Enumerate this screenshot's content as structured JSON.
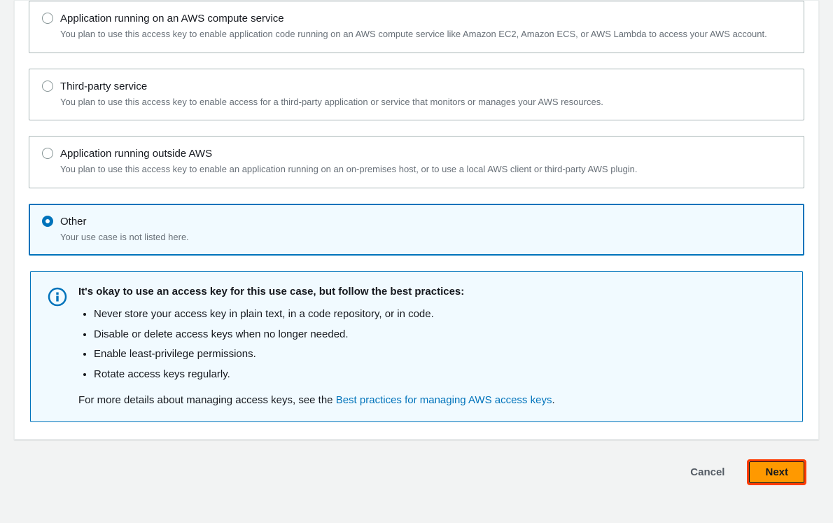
{
  "options": [
    {
      "title": "Application running on an AWS compute service",
      "desc": "You plan to use this access key to enable application code running on an AWS compute service like Amazon EC2, Amazon ECS, or AWS Lambda to access your AWS account.",
      "selected": false
    },
    {
      "title": "Third-party service",
      "desc": "You plan to use this access key to enable access for a third-party application or service that monitors or manages your AWS resources.",
      "selected": false
    },
    {
      "title": "Application running outside AWS",
      "desc": "You plan to use this access key to enable an application running on an on-premises host, or to use a local AWS client or third-party AWS plugin.",
      "selected": false
    },
    {
      "title": "Other",
      "desc": "Your use case is not listed here.",
      "selected": true
    }
  ],
  "info": {
    "title": "It's okay to use an access key for this use case, but follow the best practices:",
    "items": [
      "Never store your access key in plain text, in a code repository, or in code.",
      "Disable or delete access keys when no longer needed.",
      "Enable least-privilege permissions.",
      "Rotate access keys regularly."
    ],
    "footer_prefix": "For more details about managing access keys, see the ",
    "footer_link": "Best practices for managing AWS access keys",
    "footer_suffix": "."
  },
  "footer": {
    "cancel": "Cancel",
    "next": "Next"
  }
}
